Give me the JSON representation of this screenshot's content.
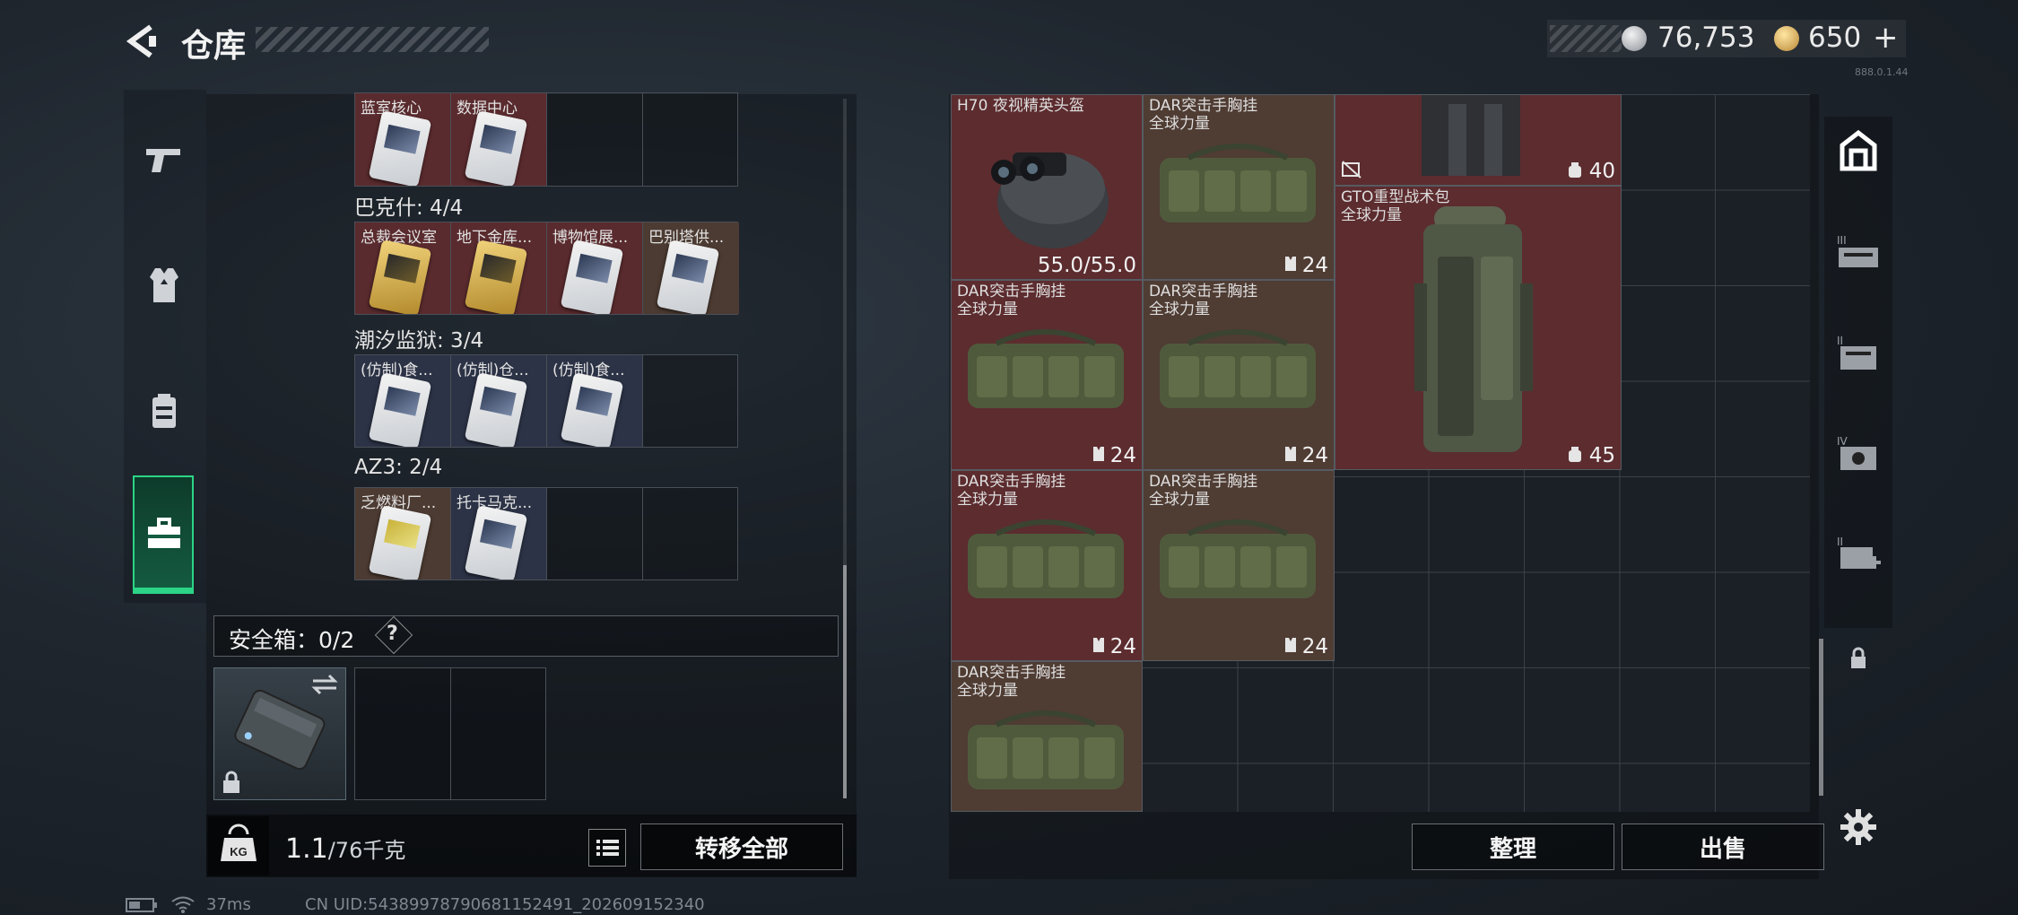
{
  "header": {
    "title": "仓库",
    "currency1": "76,753",
    "currency2": "650",
    "currency2_plus": "+",
    "version": "888.0.1.44"
  },
  "keys": {
    "rows": [
      {
        "group": "",
        "cells": [
          {
            "name": "蓝室核心",
            "bg": "red",
            "card": "white"
          },
          {
            "name": "数据中心",
            "bg": "red",
            "card": "white"
          },
          {
            "name": "",
            "bg": "",
            "card": ""
          },
          {
            "name": "",
            "bg": "",
            "card": ""
          }
        ]
      },
      {
        "group": "巴克什: 4/4",
        "cells": [
          {
            "name": "总裁会议室",
            "bg": "red",
            "card": "gold"
          },
          {
            "name": "地下金库...",
            "bg": "red",
            "card": "gold"
          },
          {
            "name": "博物馆展...",
            "bg": "red",
            "card": "white"
          },
          {
            "name": "巴别塔供...",
            "bg": "olive",
            "card": "white"
          }
        ]
      },
      {
        "group": "潮汐监狱: 3/4",
        "cells": [
          {
            "name": "(仿制)食...",
            "bg": "navy",
            "card": "white"
          },
          {
            "name": "(仿制)仓...",
            "bg": "navy",
            "card": "white"
          },
          {
            "name": "(仿制)食...",
            "bg": "navy",
            "card": "white"
          },
          {
            "name": "",
            "bg": "",
            "card": ""
          }
        ]
      },
      {
        "group": "AZ3: 2/4",
        "cells": [
          {
            "name": "乏燃料厂...",
            "bg": "olive",
            "card": "white"
          },
          {
            "name": "托卡马克...",
            "bg": "navy",
            "card": "white"
          },
          {
            "name": "",
            "bg": "",
            "card": ""
          },
          {
            "name": "",
            "bg": "",
            "card": ""
          }
        ]
      }
    ]
  },
  "safebox": {
    "label": "安全箱：0/2",
    "help": "?"
  },
  "bottom_left": {
    "weight": "1.1",
    "weight_unit": "/76千克",
    "transfer_all": "转移全部"
  },
  "stash": {
    "items": [
      {
        "name": "H70 夜视精英头盔",
        "sub": "",
        "value": "55.0/55.0",
        "kind": "helmet",
        "bg": "red"
      },
      {
        "name": "DAR突击手胸挂",
        "sub": "全球力量",
        "value": "24",
        "kind": "bag",
        "bg": "brown"
      },
      {
        "name": "",
        "sub": "",
        "value": "40",
        "kind": "pack-top",
        "bg": "red"
      },
      {
        "name": "DAR突击手胸挂",
        "sub": "全球力量",
        "value": "24",
        "kind": "bag",
        "bg": "red"
      },
      {
        "name": "DAR突击手胸挂",
        "sub": "全球力量",
        "value": "24",
        "kind": "bag",
        "bg": "brown"
      },
      {
        "name": "GTO重型战术包",
        "sub": "全球力量",
        "value": "45",
        "kind": "pack",
        "bg": "red"
      },
      {
        "name": "DAR突击手胸挂",
        "sub": "全球力量",
        "value": "24",
        "kind": "bag",
        "bg": "red"
      },
      {
        "name": "DAR突击手胸挂",
        "sub": "全球力量",
        "value": "24",
        "kind": "bag",
        "bg": "brown"
      },
      {
        "name": "DAR突击手胸挂",
        "sub": "全球力量",
        "value": "",
        "kind": "bag",
        "bg": "brown"
      }
    ],
    "sort": "整理",
    "sell": "出售"
  },
  "right_nav": [
    {
      "icon": "stash-icon",
      "label": ""
    },
    {
      "icon": "tier3-stash-icon",
      "label": "III"
    },
    {
      "icon": "tier2-stash-icon",
      "label": "II"
    },
    {
      "icon": "tier4-stash-icon",
      "label": "IV"
    },
    {
      "icon": "tier2-medical-icon",
      "label": "II"
    },
    {
      "icon": "lock-icon",
      "label": ""
    }
  ],
  "status": {
    "ping": "37ms",
    "uid": "CN UID:5438997879068115249​1_202609152340"
  },
  "colors": {
    "accent_green": "#2bd486",
    "item_red": "#5c2c2f",
    "item_brown": "#4f3c33"
  }
}
